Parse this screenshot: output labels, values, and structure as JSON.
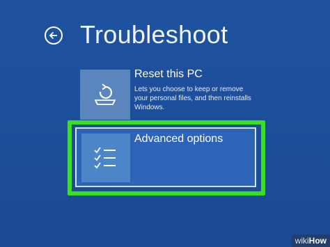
{
  "header": {
    "title": "Troubleshoot",
    "back_icon": "back-arrow-circle-icon"
  },
  "options": [
    {
      "title": "Reset this PC",
      "description": "Lets you choose to keep or remove your personal files, and then reinstalls Windows.",
      "icon": "reset-pc-icon"
    },
    {
      "title": "Advanced options",
      "description": "",
      "icon": "checklist-icon",
      "highlighted": true
    }
  ],
  "colors": {
    "background": "#1d4f9c",
    "tile_reset": "#5b86bd",
    "tile_advanced": "#4c85c8",
    "selected_bg": "#2d64b8",
    "highlight_annotation": "#39e01f"
  },
  "watermark": {
    "wiki": "wiki",
    "how": "How"
  }
}
